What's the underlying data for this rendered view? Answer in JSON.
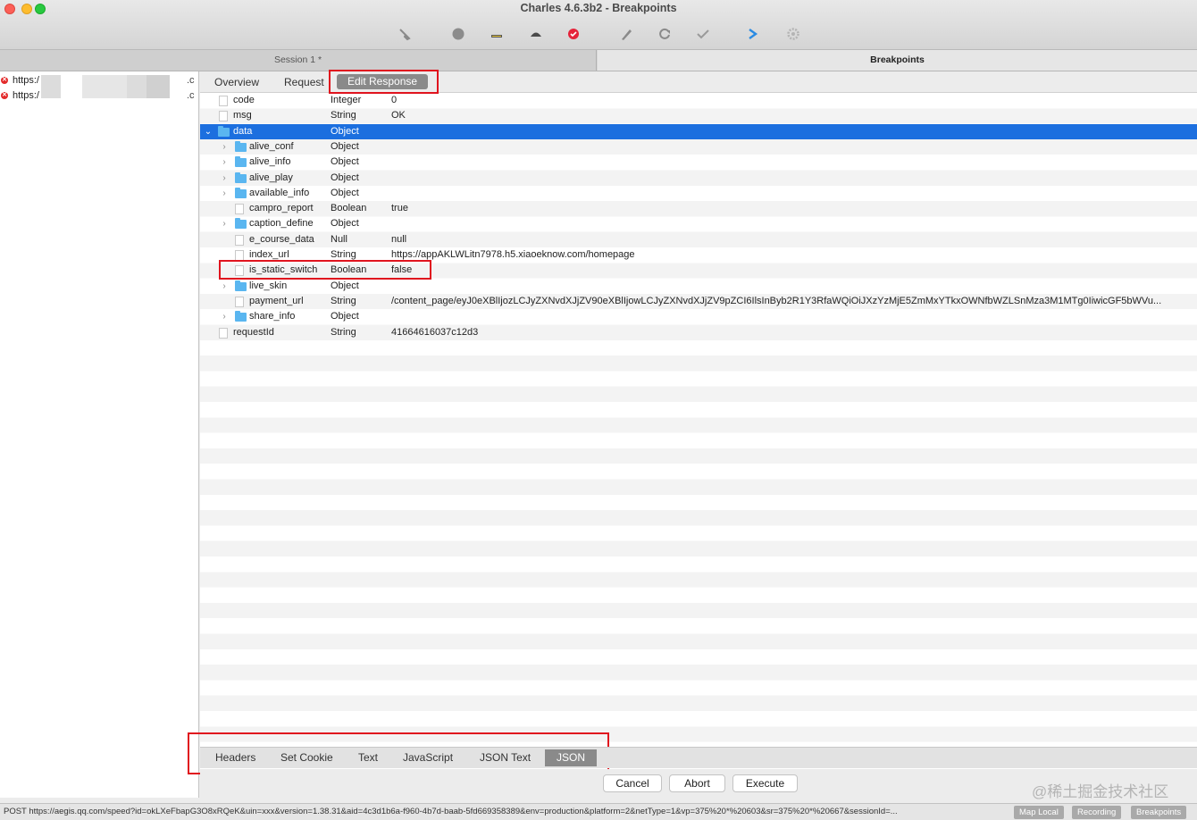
{
  "window": {
    "title": "Charles 4.6.3b2 - Breakpoints"
  },
  "toolbar": {
    "icons": [
      "broom-icon",
      "record-icon",
      "throttle-icon",
      "turtle-icon",
      "breakpoint-icon",
      "compose-icon",
      "repeat-icon",
      "validate-icon",
      "tools-icon",
      "settings-icon"
    ]
  },
  "tabs": {
    "session": "Session 1 *",
    "breakpoints": "Breakpoints"
  },
  "requests": [
    {
      "url": "https:/",
      "tail": ".c"
    },
    {
      "url": "https:/",
      "tail": ".c"
    }
  ],
  "subtabs": {
    "overview": "Overview",
    "request": "Request",
    "edit_response": "Edit Response"
  },
  "tree": [
    {
      "name": "code",
      "type": "Integer",
      "value": "0"
    },
    {
      "name": "msg",
      "type": "String",
      "value": "OK"
    },
    {
      "name": "data",
      "type": "Object",
      "value": ""
    },
    {
      "name": "alive_conf",
      "type": "Object",
      "value": ""
    },
    {
      "name": "alive_info",
      "type": "Object",
      "value": ""
    },
    {
      "name": "alive_play",
      "type": "Object",
      "value": ""
    },
    {
      "name": "available_info",
      "type": "Object",
      "value": ""
    },
    {
      "name": "campro_report",
      "type": "Boolean",
      "value": "true"
    },
    {
      "name": "caption_define",
      "type": "Object",
      "value": ""
    },
    {
      "name": "e_course_data",
      "type": "Null",
      "value": "null"
    },
    {
      "name": "index_url",
      "type": "String",
      "value": "https://appAKLWLitn7978.h5.xiaoeknow.com/homepage"
    },
    {
      "name": "is_static_switch",
      "type": "Boolean",
      "value": "false"
    },
    {
      "name": "live_skin",
      "type": "Object",
      "value": ""
    },
    {
      "name": "payment_url",
      "type": "String",
      "value": "/content_page/eyJ0eXBlIjozLCJyZXNvdXJjZV90eXBlIjowLCJyZXNvdXJjZV9pZCI6IlsInByb2R1Y3RfaWQiOiJXzYzMjE5ZmMxYTkxOWNfbWZLSnMza3M1MTg0IiwicGF5bWVu..."
    },
    {
      "name": "share_info",
      "type": "Object",
      "value": ""
    },
    {
      "name": "requestId",
      "type": "String",
      "value": "41664616037c12d3"
    }
  ],
  "bottom_tabs": {
    "headers": "Headers",
    "set_cookie": "Set Cookie",
    "text": "Text",
    "javascript": "JavaScript",
    "json_text": "JSON Text",
    "json": "JSON"
  },
  "buttons": {
    "cancel": "Cancel",
    "abort": "Abort",
    "execute": "Execute"
  },
  "watermark": "@稀土掘金技术社区",
  "status": {
    "text": "POST https://aegis.qq.com/speed?id=okLXeFbapG3O8xRQeK&uin=xxx&version=1.38.31&aid=4c3d1b6a-f960-4b7d-baab-5fd669358389&env=production&platform=2&netType=1&vp=375%20*%20603&sr=375%20*%20667&sessionId=...",
    "map_local": "Map Local",
    "recording": "Recording",
    "breakpoints": "Breakpoints"
  },
  "colors": {
    "selection": "#1c6fdf",
    "annotation": "#e0141e",
    "folder": "#5ab6f0"
  }
}
